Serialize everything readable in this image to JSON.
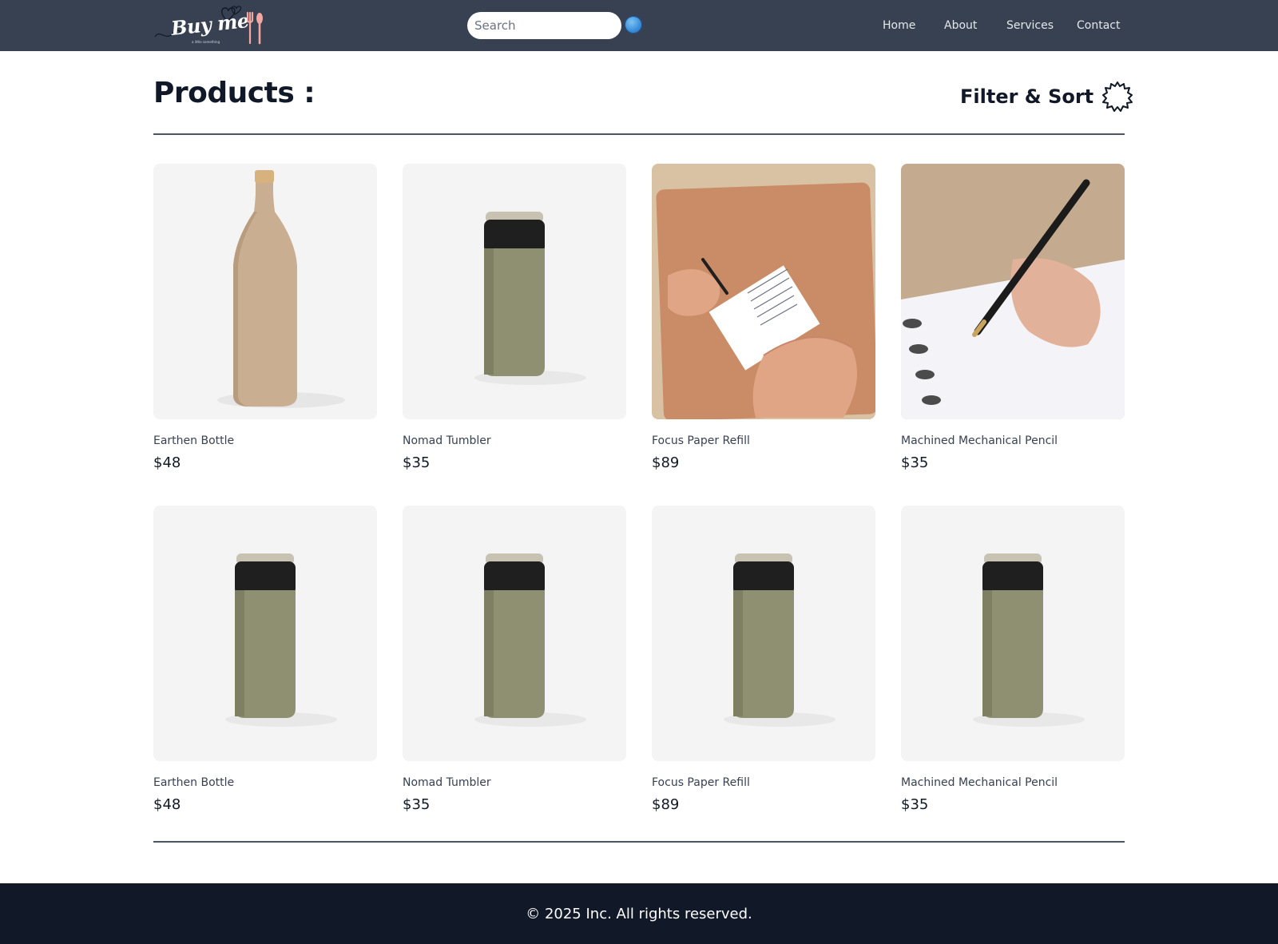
{
  "navbar": {
    "logo_text": "Buy me",
    "logo_tagline": "a little something",
    "search_placeholder": "Search",
    "links": [
      {
        "label": "Home"
      },
      {
        "label": "About"
      },
      {
        "label": "Services"
      },
      {
        "label": "Contact"
      }
    ]
  },
  "header": {
    "title": "Products :",
    "filter_label": "Filter & Sort"
  },
  "products": [
    {
      "name": "Earthen Bottle",
      "price": "$48",
      "image": "earthen-bottle"
    },
    {
      "name": "Nomad Tumbler",
      "price": "$35",
      "image": "tumbler"
    },
    {
      "name": "Focus Paper Refill",
      "price": "$89",
      "image": "paper-refill"
    },
    {
      "name": "Machined Mechanical Pencil",
      "price": "$35",
      "image": "pencil"
    },
    {
      "name": "Earthen Bottle",
      "price": "$48",
      "image": "tumbler"
    },
    {
      "name": "Nomad Tumbler",
      "price": "$35",
      "image": "tumbler"
    },
    {
      "name": "Focus Paper Refill",
      "price": "$89",
      "image": "tumbler"
    },
    {
      "name": "Machined Mechanical Pencil",
      "price": "$35",
      "image": "tumbler"
    }
  ],
  "footer": {
    "copyright": "© 2025 Inc. All rights reserved."
  },
  "colors": {
    "navbar_bg": "#374151",
    "footer_bg": "#111827",
    "card_bg": "#f4f4f4",
    "accent_logo": "#f4a6a0"
  }
}
